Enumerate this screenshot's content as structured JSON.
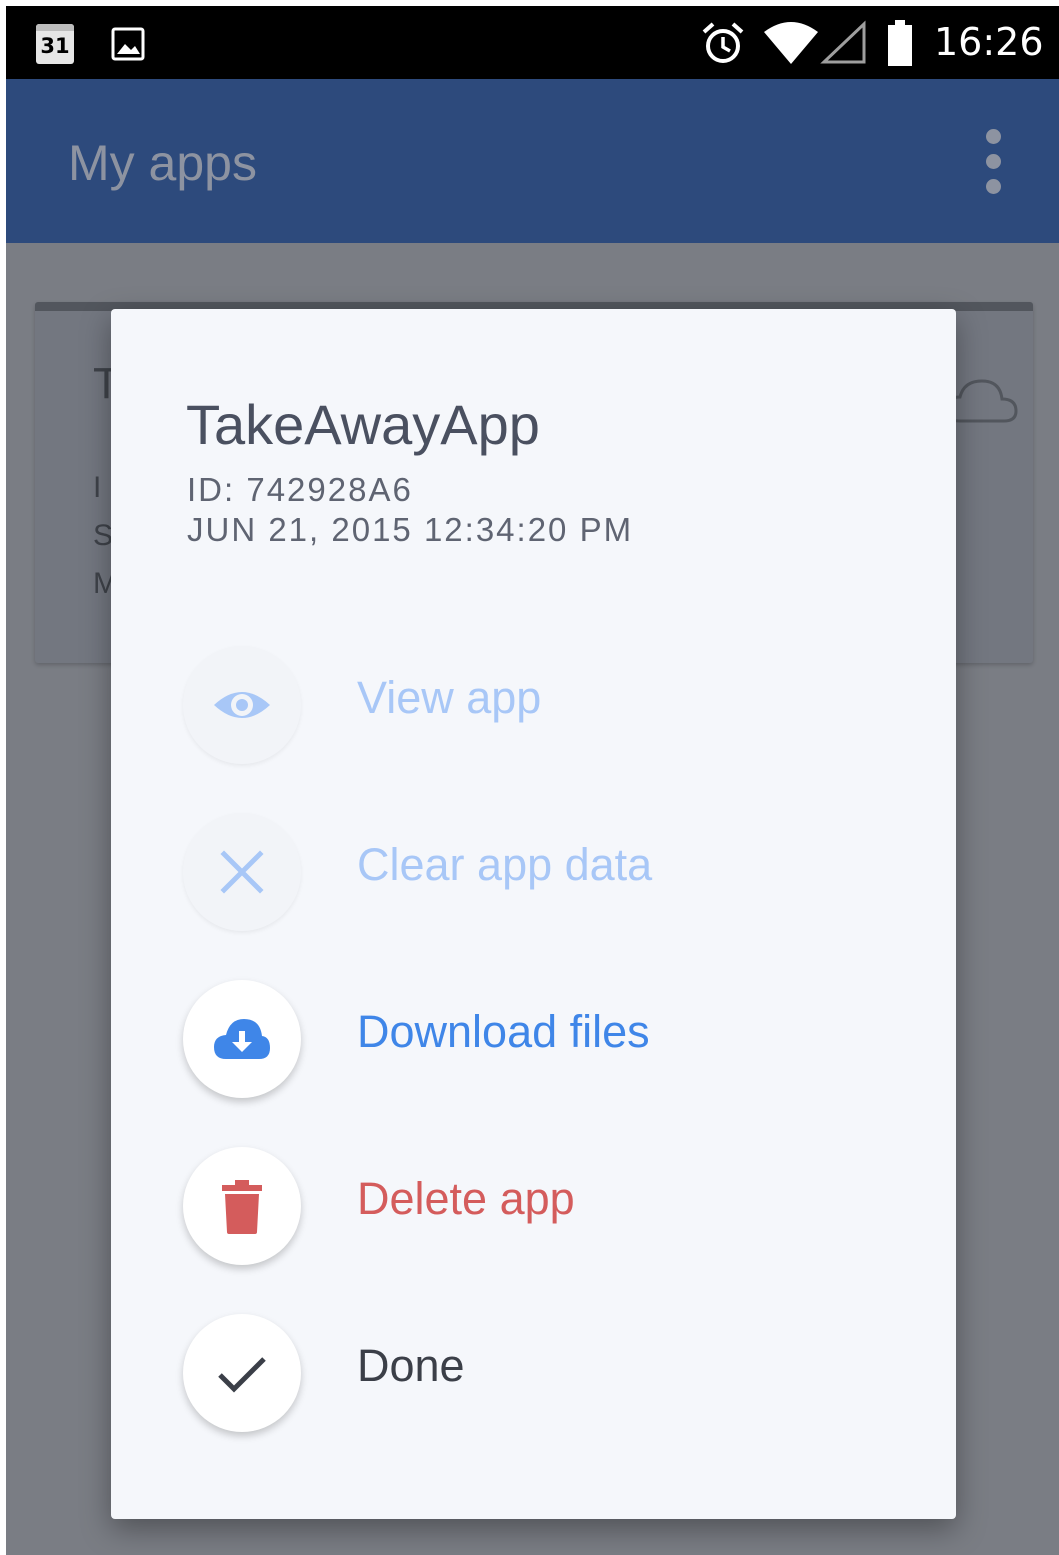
{
  "status_bar": {
    "calendar_day": "31",
    "time": "16:26",
    "icons": [
      "calendar-icon",
      "image-icon",
      "alarm-icon",
      "wifi-icon",
      "signal-icon",
      "battery-icon"
    ]
  },
  "app_bar": {
    "title": "My apps",
    "menu_icon": "more-vertical-icon"
  },
  "background_card": {
    "fragments": [
      "T",
      "I",
      "S",
      "M"
    ],
    "icon": "cloud-icon"
  },
  "dialog": {
    "title": "TakeAwayApp",
    "id_line": "ID: 742928A6",
    "date_line": "JUN 21, 2015 12:34:20 PM",
    "actions": [
      {
        "label": "View app",
        "icon": "eye-icon",
        "color": "#a8c7f7",
        "enabled": false
      },
      {
        "label": "Clear app data",
        "icon": "close-icon",
        "color": "#a8c7f7",
        "enabled": false
      },
      {
        "label": "Download files",
        "icon": "cloud-download-icon",
        "color": "#3f86e8",
        "enabled": true
      },
      {
        "label": "Delete app",
        "icon": "trash-icon",
        "color": "#d45c5c",
        "enabled": true
      },
      {
        "label": "Done",
        "icon": "check-icon",
        "color": "#3b3f48",
        "enabled": true
      }
    ]
  },
  "colors": {
    "app_bar": "#2d4a7c",
    "scrim": "#7a7d84",
    "dialog_bg": "#f5f7fb"
  }
}
